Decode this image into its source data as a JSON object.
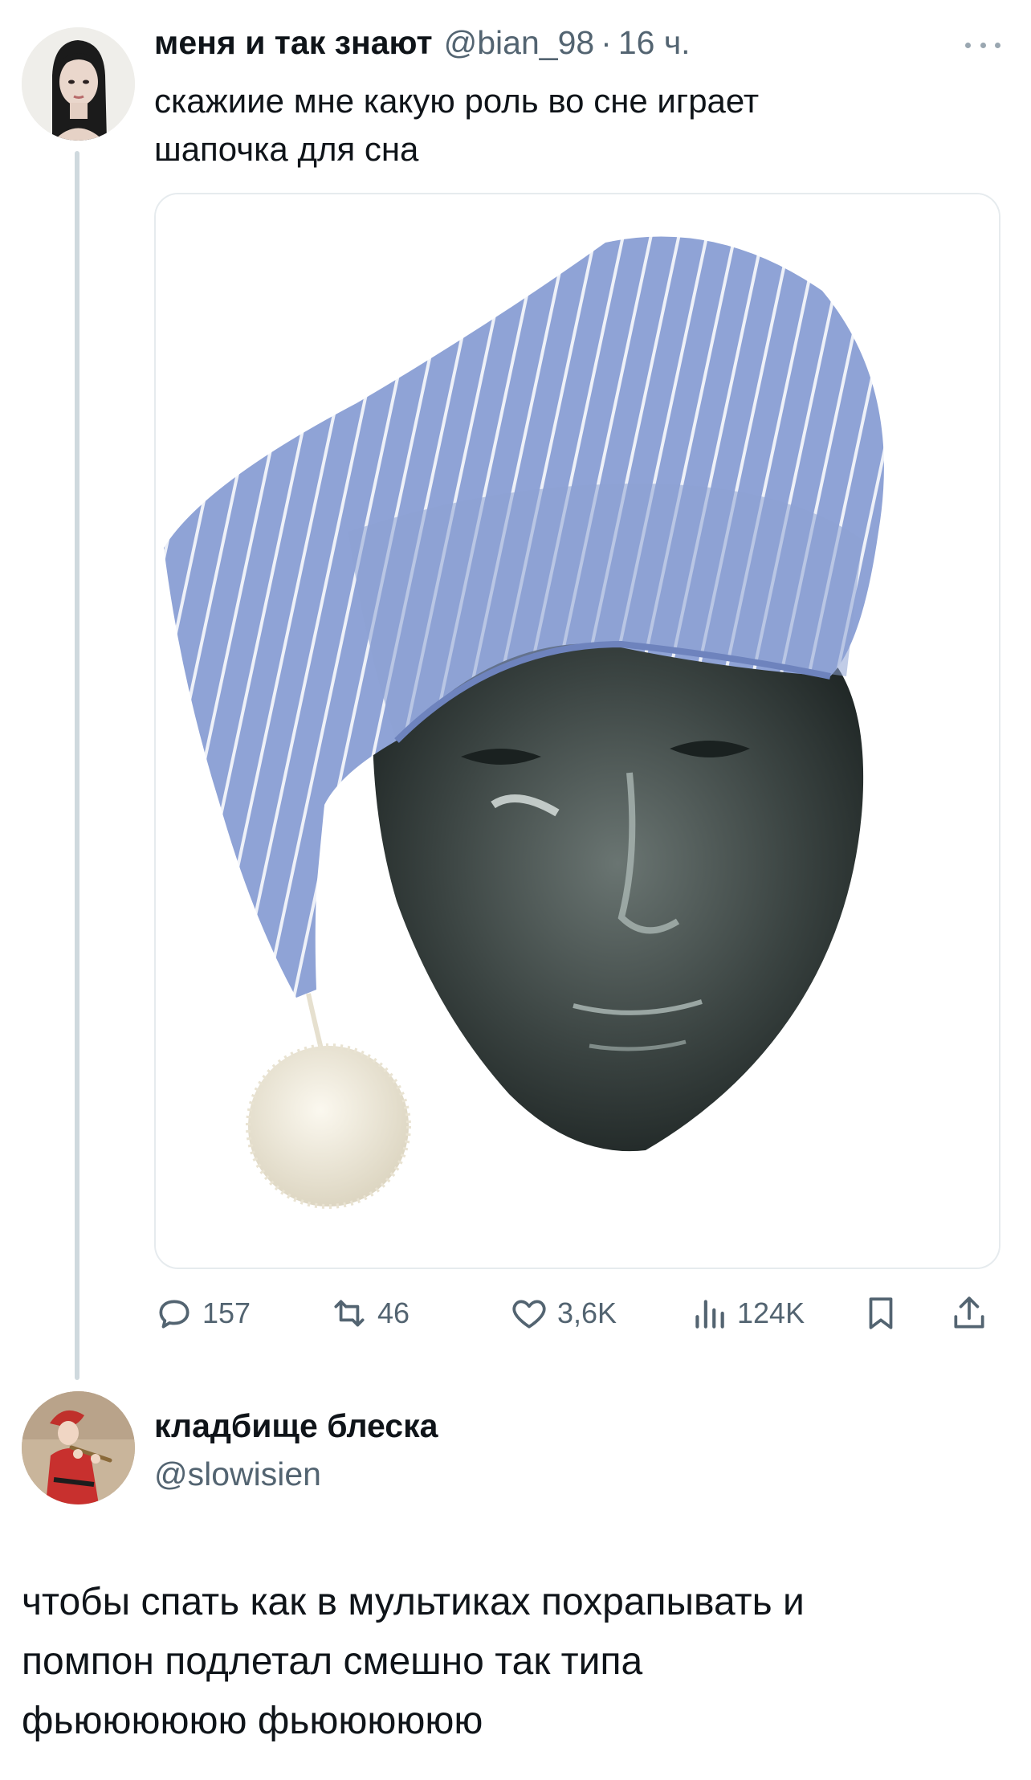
{
  "tweet": {
    "author_name": "меня и так знают",
    "author_handle": "@bian_98",
    "separator": "·",
    "time": "16 ч.",
    "text_line1": "скажиие мне какую роль во сне играет",
    "text_line2": "шапочка для сна",
    "media_description_icon": "photo-nightcap-on-glass-head",
    "counts": {
      "replies": "157",
      "retweets": "46",
      "likes": "3,6K",
      "views": "124K"
    }
  },
  "reply": {
    "author_name": "кладбище блеска",
    "author_handle": "@slowisien",
    "text_line1": "чтобы спать как в мультиках похрапывать и",
    "text_line2": "помпон подлетал смешно так типа",
    "text_line3": "фьюююююю фьюююююю"
  },
  "colors": {
    "text_primary": "#0f1419",
    "text_secondary": "#536471",
    "thread_line": "#cfd9de",
    "hat_blue": "#8fa3d6"
  },
  "icons": [
    "more-icon",
    "reply-icon",
    "retweet-icon",
    "like-icon",
    "views-icon",
    "bookmark-icon",
    "share-icon"
  ]
}
